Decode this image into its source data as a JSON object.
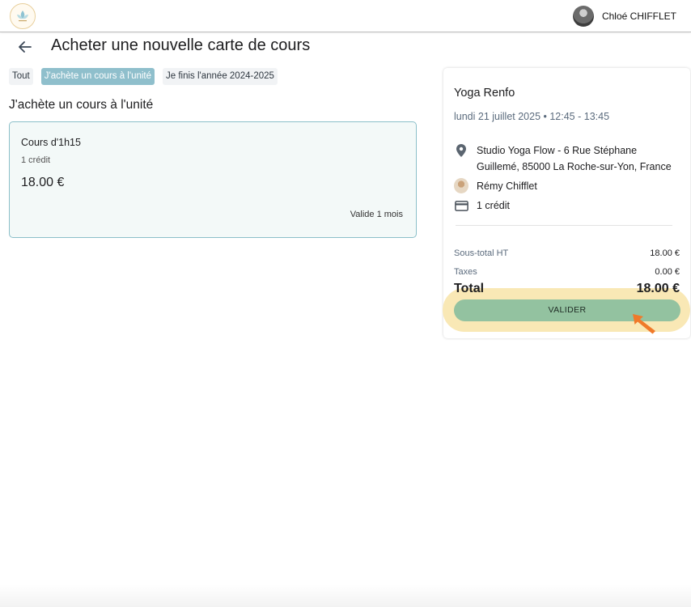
{
  "header": {
    "user_name": "Chloé CHIFFLET"
  },
  "page": {
    "title": "Acheter une nouvelle carte de cours"
  },
  "filters": [
    {
      "label": "Tout",
      "active": false
    },
    {
      "label": "J'achète un cours à l'unité",
      "active": true
    },
    {
      "label": "Je finis l'année 2024-2025",
      "active": false
    }
  ],
  "section": {
    "title": "J'achète un cours à l'unité"
  },
  "offer_card": {
    "name": "Cours d'1h15",
    "credit": "1 crédit",
    "price": "18.00 €",
    "validity": "Valide 1 mois"
  },
  "summary": {
    "course_title": "Yoga Renfo",
    "date": "lundi 21 juillet 2025 • 12:45 - 13:45",
    "location": "Studio Yoga Flow - 6 Rue Stéphane Guillemé, 85000 La Roche-sur-Yon, France",
    "teacher": "Rémy Chifflet",
    "credits": "1 crédit",
    "subtotal_label": "Sous-total HT",
    "subtotal_value": "18.00 €",
    "taxes_label": "Taxes",
    "taxes_value": "0.00 €",
    "total_label": "Total",
    "total_value": "18.00 €",
    "validate_label": "VALIDER"
  },
  "colors": {
    "accent_chip": "#8fbfcc",
    "card_border": "#8bbfc9",
    "validate_button": "#93c2a0",
    "highlight": "#f9e8b5",
    "cursor": "#f07a2a"
  },
  "icons": {
    "back": "arrow-left-icon",
    "location": "location-pin-icon",
    "credit": "credit-card-icon",
    "cursor": "mouse-cursor-icon"
  }
}
